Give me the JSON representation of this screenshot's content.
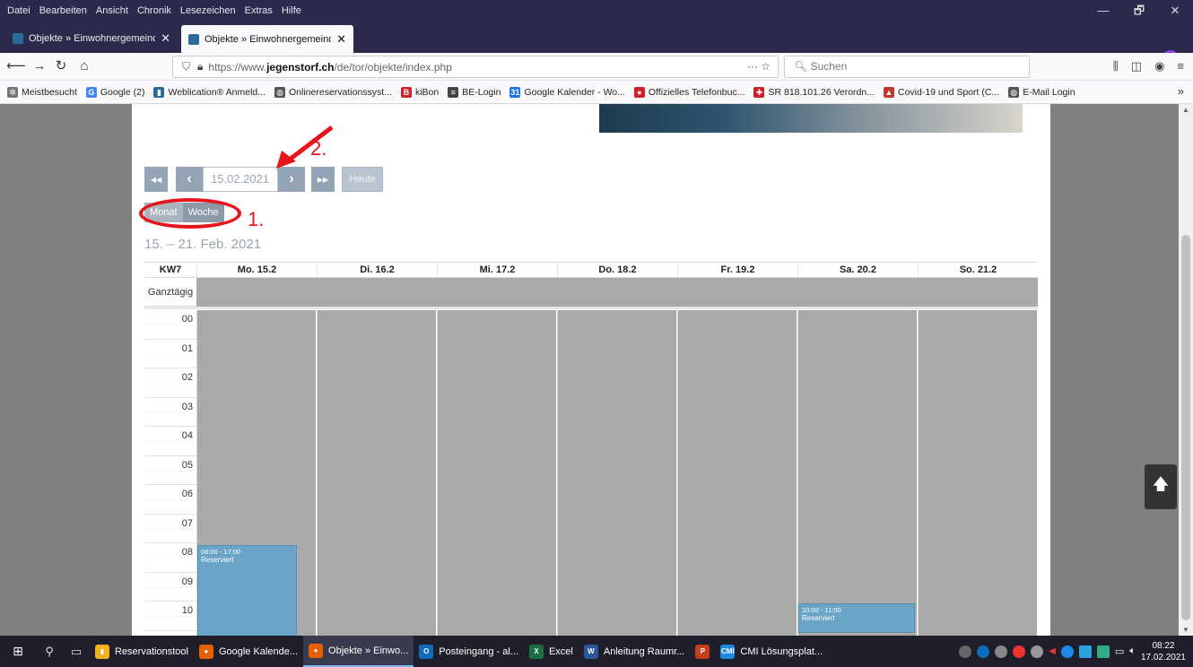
{
  "menubar": {
    "items": [
      "Datei",
      "Bearbeiten",
      "Ansicht",
      "Chronik",
      "Lesezeichen",
      "Extras",
      "Hilfe"
    ]
  },
  "window": {
    "minimize": "—",
    "restore": "🗗",
    "close": "✕"
  },
  "tabs": [
    {
      "title": "Objekte » Einwohnergemeinde",
      "active": false
    },
    {
      "title": "Objekte » Einwohnergemeinde",
      "active": true
    }
  ],
  "newtab": "+",
  "nav": {
    "url_prefix": "https://www.",
    "url_domain": "jegenstorf.ch",
    "url_path": "/de/tor/objekte/index.php",
    "url_actions": "··· ☆",
    "search_placeholder": "Suchen"
  },
  "bookmarks": [
    {
      "label": "Meistbesucht",
      "color": "#777777",
      "glyph": "✲"
    },
    {
      "label": "Google (2)",
      "color": "#4285f4",
      "glyph": "G"
    },
    {
      "label": "Weblication® Anmeld...",
      "color": "#2c6b9a",
      "glyph": "▮"
    },
    {
      "label": "Onlinereservationssyst...",
      "color": "#555555",
      "glyph": "◍"
    },
    {
      "label": "kiBon",
      "color": "#d0202a",
      "glyph": "B"
    },
    {
      "label": "BE-Login",
      "color": "#444444",
      "glyph": "≡"
    },
    {
      "label": "Google Kalender - Wo...",
      "color": "#1a73e8",
      "glyph": "31"
    },
    {
      "label": "Offizielles Telefonbuc...",
      "color": "#d0202a",
      "glyph": "●"
    },
    {
      "label": "SR 818.101.26 Verordn...",
      "color": "#d0202a",
      "glyph": "✚"
    },
    {
      "label": "Covid-19 und Sport (C...",
      "color": "#c0392b",
      "glyph": "▲"
    },
    {
      "label": "E-Mail Login",
      "color": "#555555",
      "glyph": "◍"
    }
  ],
  "bookmarks_more": "»",
  "calendar": {
    "nav": {
      "first": "◀◀",
      "prev": "‹",
      "date_value": "15.02.2021",
      "next": "›",
      "last": "▶▶",
      "today": "Heute"
    },
    "views": {
      "month": "Monat",
      "week": "Woche"
    },
    "range_title": "15. – 21. Feb. 2021",
    "week_label": "KW7",
    "days": [
      "Mo. 15.2",
      "Di. 16.2",
      "Mi. 17.2",
      "Do. 18.2",
      "Fr. 19.2",
      "Sa. 20.2",
      "So. 21.2"
    ],
    "all_day_label": "Ganztägig",
    "hours": [
      "00",
      "01",
      "02",
      "03",
      "04",
      "05",
      "06",
      "07",
      "08",
      "09",
      "10"
    ],
    "events": [
      {
        "day": 0,
        "start_hour": 8.0,
        "end_hour": 17.0,
        "time": "08:00 - 17:00",
        "label": "Reserviert"
      },
      {
        "day": 5,
        "start_hour": 10.0,
        "end_hour": 11.0,
        "time": "10:00 - 11:00",
        "label": "Reserviert"
      }
    ]
  },
  "annotations": {
    "step1": "1.",
    "step2": "2."
  },
  "scroll_to_top": "🡅",
  "taskbar": {
    "apps": [
      {
        "label": "Reservationstool",
        "color": "#f2b01e",
        "glyph": "▮",
        "active": false
      },
      {
        "label": "Google Kalende...",
        "color": "#e66000",
        "glyph": "●",
        "active": false
      },
      {
        "label": "Objekte » Einwo...",
        "color": "#e66000",
        "glyph": "●",
        "active": true
      },
      {
        "label": "Posteingang - al...",
        "color": "#0f6cbd",
        "glyph": "O",
        "active": false
      },
      {
        "label": "Excel",
        "color": "#1d6f42",
        "glyph": "X",
        "active": false
      },
      {
        "label": "Anleitung Raumr...",
        "color": "#2b579a",
        "glyph": "W",
        "active": false
      },
      {
        "label": "",
        "color": "#c43e1c",
        "glyph": "P",
        "active": false
      },
      {
        "label": "CMI Lösungsplat...",
        "color": "#1e88e5",
        "glyph": "CMI",
        "active": false
      }
    ],
    "time": "08:22",
    "date": "17.02.2021"
  }
}
